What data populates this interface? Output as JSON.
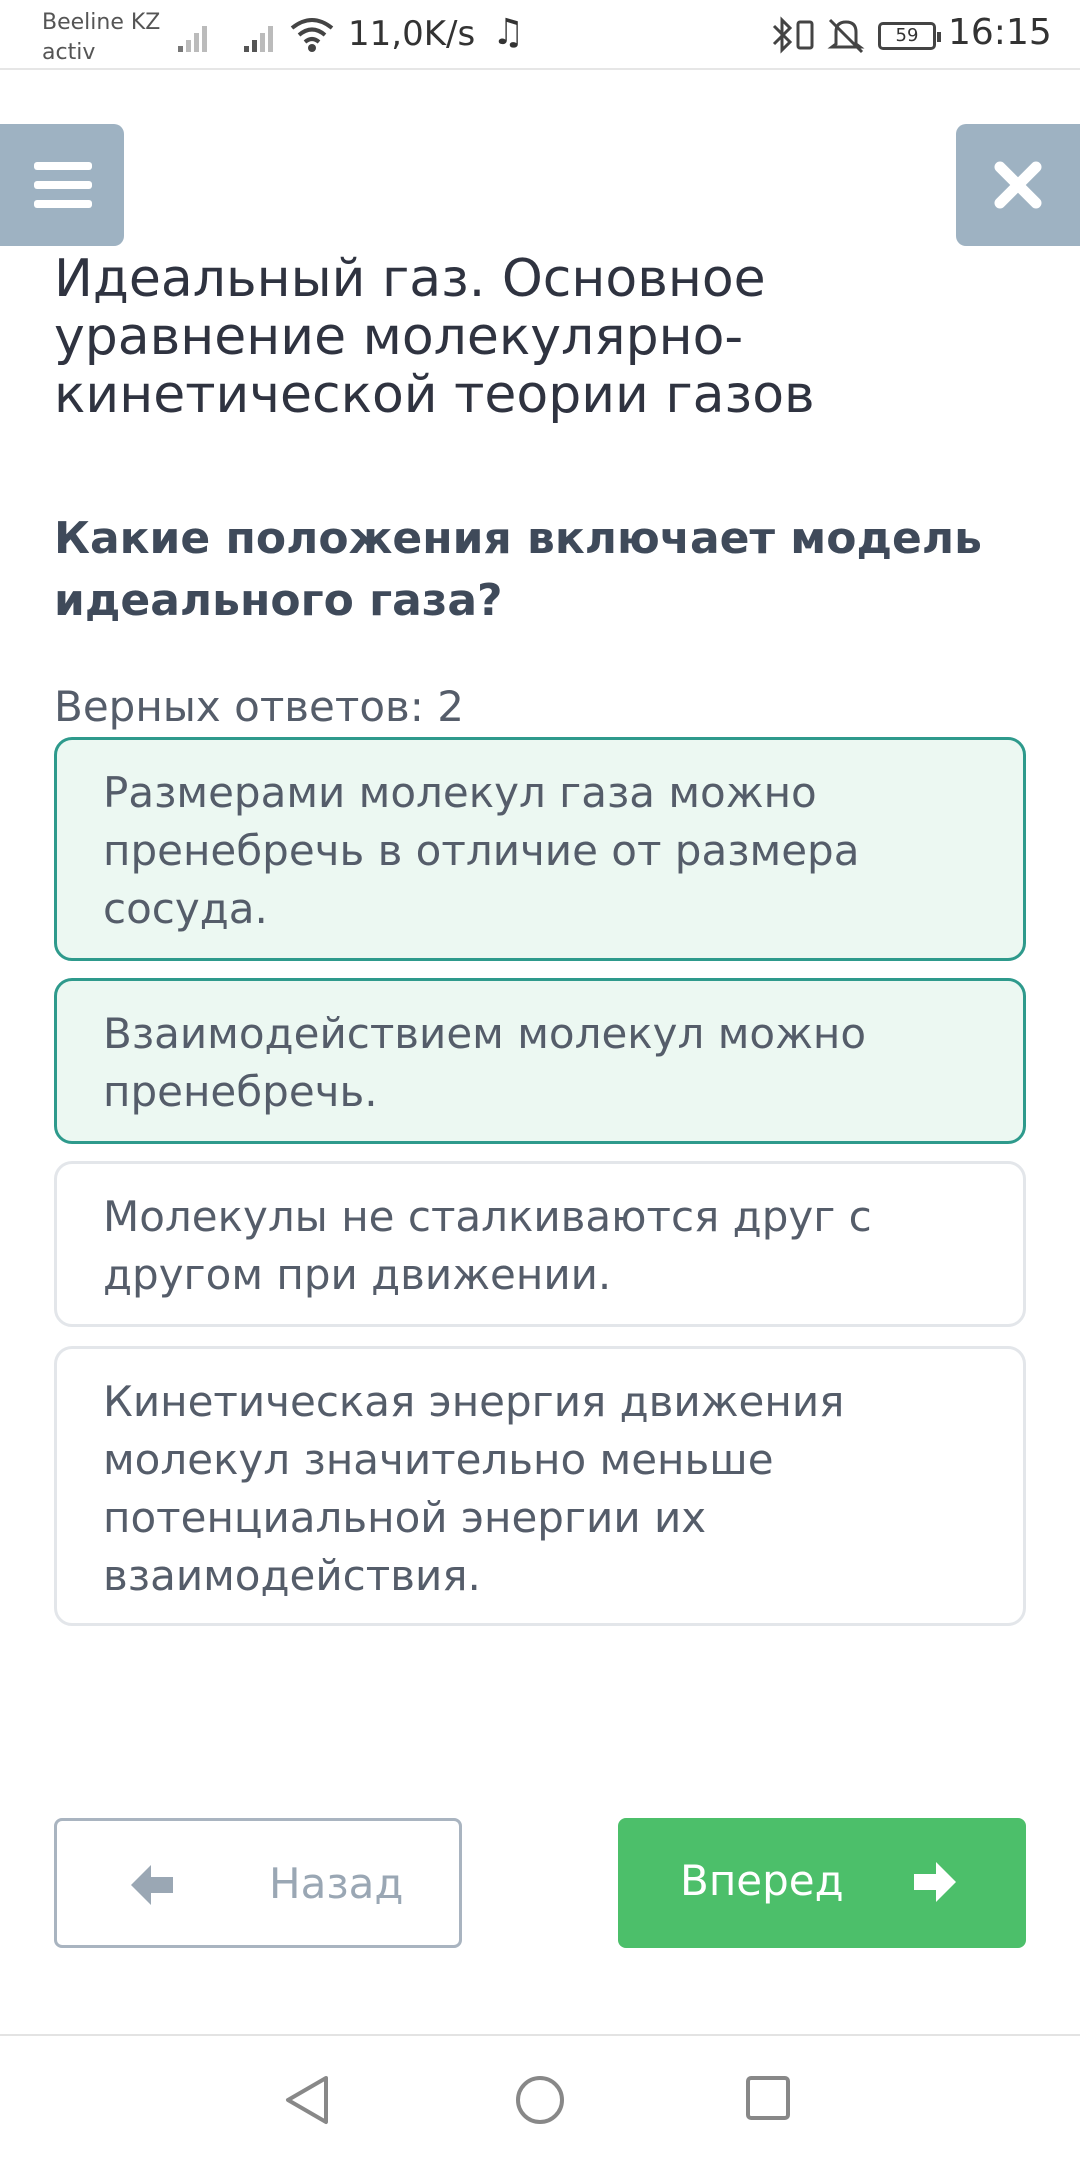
{
  "status_bar": {
    "carrier_line1": "Beeline KZ",
    "carrier_line2": "activ",
    "network_speed": "11,0K/s",
    "battery_level": "59",
    "time": "16:15",
    "icons": [
      "signal-icon",
      "signal-icon",
      "wifi-icon",
      "music-note-icon",
      "bluetooth-icon",
      "vibrate-icon",
      "bell-off-icon",
      "battery-icon"
    ]
  },
  "header": {
    "menu_icon": "hamburger-menu-icon",
    "close_icon": "close-icon",
    "title": "Идеальный газ. Основное уравнение молекулярно-кинетической теории газов"
  },
  "question": {
    "text": "Какие положения включает модель идеального газа?",
    "correct_count": "Верных ответов: 2"
  },
  "answers": [
    {
      "text": "Размерами молекул газа можно пренебречь в отличие от размера сосуда.",
      "selected": true
    },
    {
      "text": "Взаимодействием молекул можно пренебречь.",
      "selected": true
    },
    {
      "text": "Молекулы не сталкиваются друг с другом при движении.",
      "selected": false
    },
    {
      "text": "Кинетическая энергия движения молекул значительно меньше потенциальной энергии их взаимодействия.",
      "selected": false
    }
  ],
  "navigation": {
    "back_label": "Назад",
    "next_label": "Вперед",
    "back_icon": "arrow-left-icon",
    "next_icon": "arrow-right-icon"
  },
  "system_nav": {
    "icons": [
      "nav-back-icon",
      "nav-home-icon",
      "nav-recents-icon"
    ]
  },
  "colors": {
    "accent_green": "#4cbf6a",
    "selected_border": "#2e9a8c",
    "selected_bg": "#ecf8f2",
    "header_button": "#9eb2c2"
  }
}
